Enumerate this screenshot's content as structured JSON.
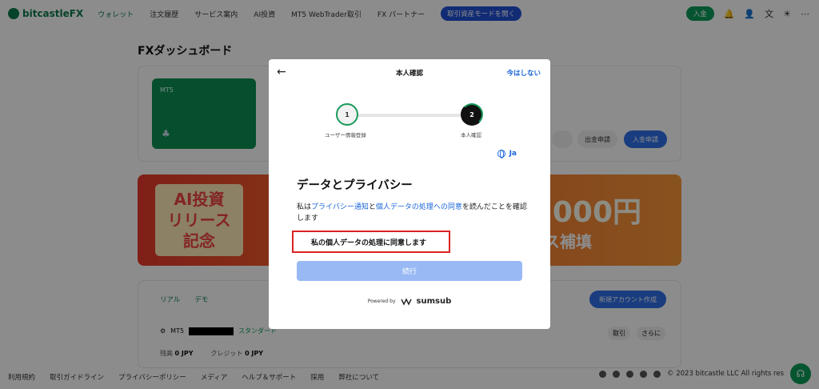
{
  "nav": {
    "logo": "bitcastleFX",
    "items": [
      "ウォレット",
      "注文履歴",
      "サービス案内",
      "AI投資",
      "MT5 WebTrader取引",
      "FX パートナー"
    ],
    "pill": "取引資産モードを開く",
    "deposit": "入金"
  },
  "page": {
    "title": "FXダッシュボード",
    "card_label": "MT5",
    "withdraw": "出金申請",
    "deposit_request": "入金申請",
    "banner_ai": "AI投資",
    "banner_release": "リリース",
    "banner_kinen": "記念",
    "banner_amount": "000円",
    "banner_bonus": "ス補填",
    "tabs": [
      "リアル",
      "デモ"
    ],
    "new_account": "新規アカウント作成",
    "account_prefix": "MT5",
    "account_type": "スタンダード",
    "balance_label": "残高",
    "balance_value": "0 JPY",
    "credit_label": "クレジット",
    "credit_value": "0 JPY",
    "trade": "取引",
    "more": "さらに"
  },
  "footer": {
    "links": [
      "利用規約",
      "取引ガイドライン",
      "プライバシーポリシー",
      "メディア",
      "ヘルプ＆サポート",
      "採用",
      "弊社について"
    ],
    "copyright": "© 2023 bitcastle LLC All rights res"
  },
  "modal": {
    "title": "本人確認",
    "skip": "今はしない",
    "steps": [
      {
        "number": "1",
        "label": "ユーザー情報登録"
      },
      {
        "number": "2",
        "label": "本人確認"
      }
    ],
    "language": "Ja",
    "heading": "データとプライバシー",
    "consent_prefix": "私は",
    "privacy_link": "プライバシー通知",
    "consent_and": "と",
    "processing_link": "個人データの処理への同意",
    "consent_suffix": "を読んだことを確認します",
    "checkbox_label": "私の個人データの処理に同意します",
    "continue": "続行",
    "powered_by": "Powered by",
    "brand": "sumsub"
  },
  "colors": {
    "accent_green": "#0b9b5a",
    "link_blue": "#1a66d9",
    "button_disabled": "#98b9f3",
    "highlight_red": "#dd2222"
  }
}
